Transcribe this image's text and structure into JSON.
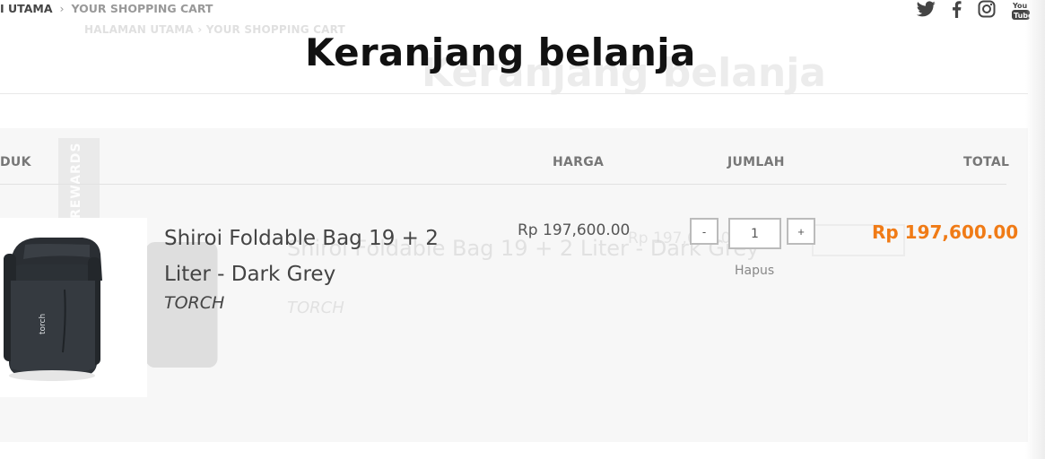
{
  "breadcrumb": {
    "home": "I UTAMA",
    "separator": "›",
    "current": "YOUR SHOPPING CART"
  },
  "ghost": {
    "breadcrumb": "HALAMAN UTAMA  ›  YOUR SHOPPING CART",
    "title": "Keranjang belanja",
    "col_produk": "PRODUK",
    "col_harga": "HARGA",
    "col_jumlah": "JUMLAH",
    "product_name": "Shiroi Foldable Bag 19 + 2 Liter - Dark Grey",
    "brand": "TORCH",
    "price": "Rp 197,600.00",
    "rewards": "REWARDS"
  },
  "social": {
    "icons": [
      "twitter-icon",
      "facebook-icon",
      "instagram-icon",
      "youtube-icon"
    ]
  },
  "page": {
    "title": "Keranjang belanja"
  },
  "table": {
    "columns": {
      "produk": "DUK",
      "harga": "HARGA",
      "jumlah": "JUMLAH",
      "total": "TOTAL"
    },
    "items": [
      {
        "name": "Shiroi Foldable Bag 19 + 2 Liter - Dark Grey",
        "brand": "TORCH",
        "price": "Rp 197,600.00",
        "qty_minus": "-",
        "qty": "1",
        "qty_plus": "+",
        "remove": "Hapus",
        "total": "Rp 197,600.00",
        "product_logo": "torch"
      }
    ]
  },
  "colors": {
    "accent": "#f07b16",
    "panel": "#f7f7f7",
    "text": "#444444"
  }
}
